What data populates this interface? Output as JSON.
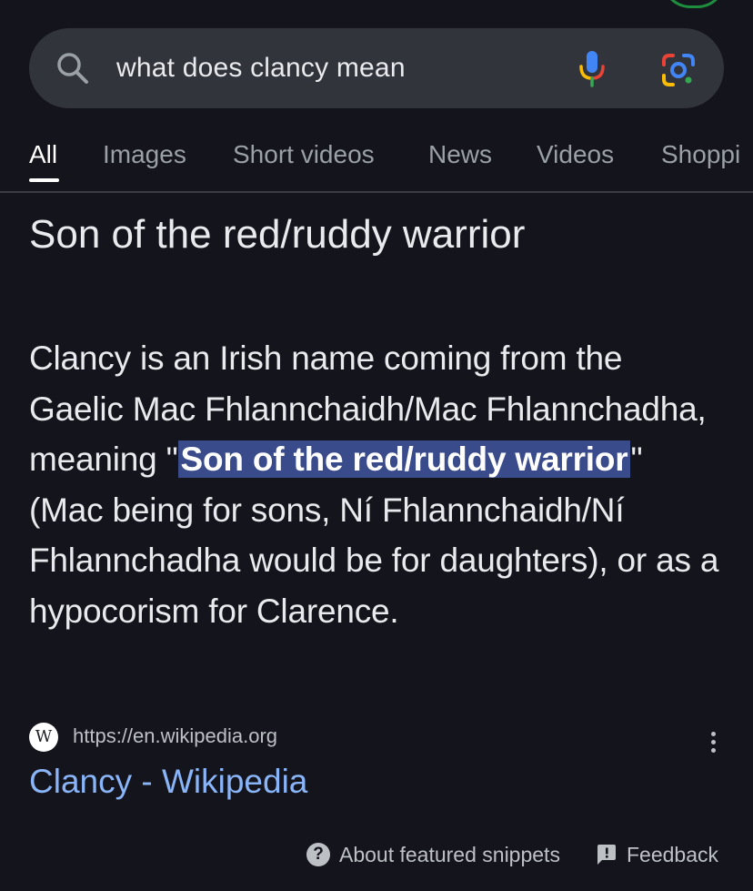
{
  "search": {
    "query": "what does clancy mean"
  },
  "tabs": [
    {
      "label": "All",
      "active": true
    },
    {
      "label": "Images"
    },
    {
      "label": "Short videos"
    },
    {
      "label": "News"
    },
    {
      "label": "Videos"
    },
    {
      "label": "Shoppi"
    }
  ],
  "featured_snippet": {
    "headline": "Son of the red/ruddy warrior",
    "body_before": "Clancy is an Irish name coming from the Gaelic Mac Fhlannchaidh/Mac Fhlannchadha, meaning \"",
    "highlight": "Son of the red/ruddy warrior",
    "body_after": "\" (Mac being for sons, Ní Fhlannchaidh/Ní Fhlannchadha would be for daughters), or as a hypocorism for Clarence.",
    "source_favicon": "W",
    "source_url": "https://en.wikipedia.org",
    "result_title": "Clancy - Wikipedia"
  },
  "footer": {
    "about_label": "About featured snippets",
    "feedback_label": "Feedback"
  },
  "colors": {
    "background": "#14141c",
    "search_bar": "#32343c",
    "highlight": "#394b8a",
    "link": "#8ab4f8"
  }
}
